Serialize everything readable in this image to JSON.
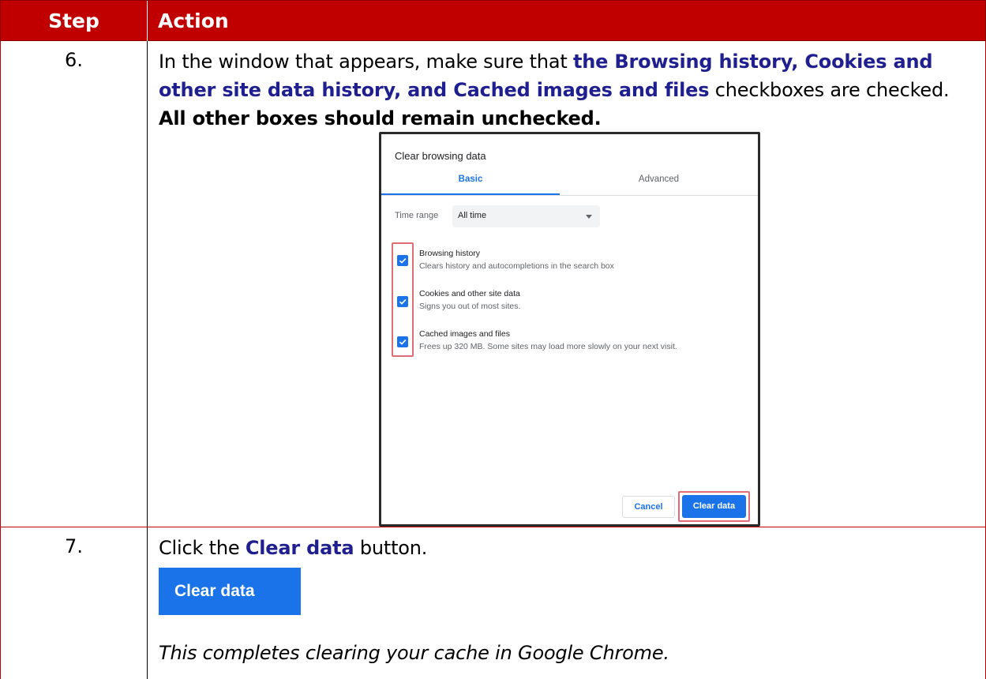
{
  "table": {
    "header": {
      "step": "Step",
      "action": "Action"
    },
    "row6": {
      "step": "6.",
      "text": {
        "part1": "In the window that appears, make sure that ",
        "highlight": "the Browsing history, Cookies and other site data history, and Cached images and files",
        "part2": " checkboxes are checked. ",
        "bold": "All other boxes should remain unchecked."
      }
    },
    "row7": {
      "step": "7.",
      "text": {
        "part1": "Click the ",
        "highlight": "Clear data",
        "part2": " button."
      },
      "button_label": "Clear data",
      "note": "This completes clearing your cache in Google Chrome."
    }
  },
  "dialog": {
    "title": "Clear browsing data",
    "tabs": [
      {
        "label": "Basic",
        "active": true
      },
      {
        "label": "Advanced",
        "active": false
      }
    ],
    "time_range": {
      "label": "Time range",
      "value": "All time"
    },
    "items": [
      {
        "title": "Browsing history",
        "desc": "Clears history and autocompletions in the search box",
        "checked": true
      },
      {
        "title": "Cookies and other site data",
        "desc": "Signs you out of most sites.",
        "checked": true
      },
      {
        "title": "Cached images and files",
        "desc": "Frees up 320 MB. Some sites may load more slowly on your next visit.",
        "checked": true
      }
    ],
    "buttons": {
      "cancel": "Cancel",
      "clear": "Clear data"
    }
  },
  "colors": {
    "header_bg": "#c00000",
    "highlight_text": "#1f1f8f",
    "chrome_blue": "#1a73e8",
    "annotation_red": "#e06c75"
  }
}
